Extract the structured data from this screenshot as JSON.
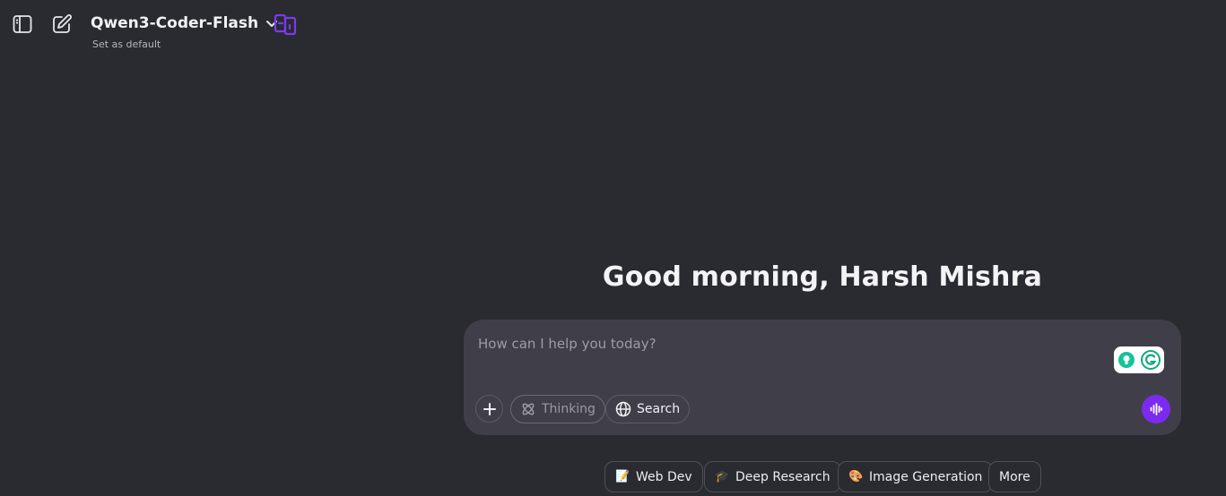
{
  "header": {
    "model_name": "Qwen3-Coder-Flash",
    "set_default_label": "Set as default",
    "icons": [
      "sidebar-toggle-icon",
      "new-chat-icon",
      "chevron-down-icon",
      "compare-models-icon"
    ]
  },
  "main": {
    "greeting": "Good morning, Harsh Mishra"
  },
  "composer": {
    "placeholder": "How can I help you today?",
    "chips": {
      "thinking_label": "Thinking",
      "search_label": "Search"
    },
    "icons": [
      "plus-icon",
      "thinking-icon",
      "globe-icon",
      "voice-icon",
      "grammarly-icon"
    ]
  },
  "suggestions": {
    "web_dev_label": "Web Dev",
    "web_dev_emoji": "📝",
    "deep_research_label": "Deep Research",
    "deep_research_emoji": "🎓",
    "image_generation_label": "Image Generation",
    "image_generation_emoji": "🎨",
    "more_label": "More"
  },
  "colors": {
    "background": "#2a2a31",
    "composer": "#403f49",
    "accent": "#7b2bf0",
    "compare_icon": "#7c3aed"
  }
}
